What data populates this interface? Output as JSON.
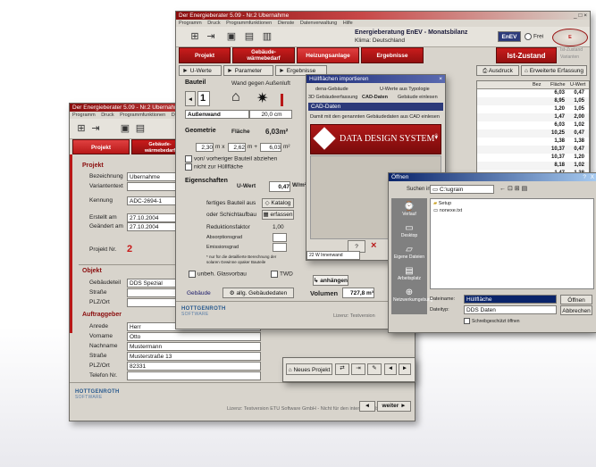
{
  "win1": {
    "title": "Der Energieberater 5.09 - Nr.2 Ubernahme",
    "menu": [
      "Programm",
      "Druck",
      "Programmfunktionen",
      "Dienste"
    ],
    "tabs": [
      "Projekt",
      "Gebäude-\nwärmebedarf"
    ],
    "projekt_section": "Projekt",
    "fields": [
      {
        "label": "Bezeichnung",
        "value": "Ubernahme"
      },
      {
        "label": "Variantentext",
        "value": ""
      },
      {
        "label": "Kennung",
        "value": "ADC-2694-1"
      },
      {
        "label": "Erstellt am",
        "value": "27.10.2004"
      },
      {
        "label": "Geändert am",
        "value": "27.10.2004"
      }
    ],
    "projekt_nr_label": "Projekt Nr.",
    "projekt_nr": "2",
    "objekt_section": "Objekt",
    "objekt_fields": [
      {
        "label": "Gebäudeteil",
        "value": "DDS Spezial"
      },
      {
        "label": "Straße",
        "value": ""
      },
      {
        "label": "PLZ/Ort",
        "value": ""
      }
    ],
    "auftrag_section": "Auftraggeber",
    "auftrag_fields": [
      {
        "label": "Anrede",
        "value": "Herr"
      },
      {
        "label": "Vorname",
        "value": "Otto"
      },
      {
        "label": "Nachname",
        "value": "Mustermann"
      },
      {
        "label": "Straße",
        "value": "Musterstraße 13"
      },
      {
        "label": "PLZ/Ort",
        "value": "82331"
      },
      {
        "label": "Telefon Nr.",
        "value": ""
      }
    ],
    "logo": "HOTTGENROTH",
    "logo_sub": "SOFTWARE",
    "license": "Lizenz: Testversion ETU Software GmbH - Nicht für den internen Gebrauch",
    "weiter": "weiter ►",
    "back": "◄"
  },
  "win2": {
    "title": "Der Energieberater 5.09 - Nr.2 Ubernahme",
    "menu": [
      "Programm",
      "Druck",
      "Programmfunktionen",
      "Dienste",
      "Datenverwaltung",
      "Hilfe"
    ],
    "header_title": "Energieberatung EnEV - Monatsbilanz",
    "klima": "Klima: Deutschland",
    "enev_btn": "EnEV",
    "frei": "Frei",
    "tabs": [
      "Projekt",
      "Gebäude-\nwärmebedarf",
      "Heizungsanlage",
      "Ergebnisse"
    ],
    "ist_zustand": "Ist-Zustand",
    "ist_side": [
      "Ist-Zustand",
      "Varianten"
    ],
    "subtabs": [
      "U-Werte",
      "Parameter",
      "Ergebnisse"
    ],
    "ausdruck": "Ausdruck",
    "erweiterte": "Erweiterte Erfassung",
    "bauteil_label": "Bauteil",
    "wand_label": "Wand gegen Außenluft",
    "counter": "1",
    "aussenwand": "Außenwand",
    "dicke": "20,0 cm",
    "geometrie_label": "Geometrie",
    "flaeche_label": "Fläche",
    "flaeche_value": "6,03m²",
    "geo_values": [
      "2,30",
      "2,62",
      "6,03"
    ],
    "geo_unit": "m²",
    "check1": "von/ vorheriger Bauteil abziehen",
    "check2": "nicht zur Hüllfläche",
    "eigen_label": "Eigenschaften",
    "uwert_label": "U-Wert",
    "uwert_value": "0,47",
    "uwert_unit": "W/m²K",
    "fertig_label": "fertiges Bauteil aus",
    "katalog": "Katalog",
    "schicht_label": "oder Schichtaufbau",
    "erfassen": "erfassen",
    "reduktion_label": "Reduktionsfaktor",
    "reduktion_value": "1,00",
    "absorption_label": "Absorptionsgrad",
    "emission_label": "Emissionsgrad",
    "note": "* nur für die detaillierte Berechnung der solaren Gewinne opaker Bauteile",
    "unbeh": "unbeh. Glasvorbau",
    "twd": "TWD",
    "gebaeude": "Gebäude",
    "allg": "allg. Gebäudedaten",
    "volumen_label": "Volumen",
    "volumen_value": "727,8 m³",
    "logo": "HOTTGENROTH",
    "logo_sub": "SOFTWARE",
    "license": "Lizenz: Testversion",
    "neues_projekt": "Neues Projekt",
    "anhaengen": "anhängen",
    "grid_headers": [
      "Bez",
      "Fläche",
      "U-Wert"
    ],
    "grid_rows": [
      [
        "6,03",
        "0,47"
      ],
      [
        "8,95",
        "1,05"
      ],
      [
        "1,20",
        "1,05"
      ],
      [
        "1,47",
        "2,00"
      ],
      [
        "6,03",
        "1,02"
      ],
      [
        "10,25",
        "0,47"
      ],
      [
        "1,38",
        "1,38"
      ],
      [
        "10,37",
        "0,47"
      ],
      [
        "10,37",
        "1,20"
      ],
      [
        "8,18",
        "1,02"
      ],
      [
        "1,47",
        "1,38"
      ]
    ]
  },
  "dialog": {
    "title": "Hüllflächen importieren",
    "tabs_row1": [
      "dena-Gebäude",
      "U-Werte aus Typologie"
    ],
    "tabs_row2": [
      "3D Gebäudeerfassung",
      "CAD-Daten",
      "Gebäude einlesen"
    ],
    "cad_header": "CAD-Daten",
    "desc": "Damit mit den genannten Gebäudedaten aus CAD einlesen",
    "dds": "DATA DESIGN SYSTEM",
    "reg": "®",
    "ok": "?",
    "list_row": [
      "22",
      "W",
      "Innenwand"
    ]
  },
  "filedlg": {
    "title": "Öffnen",
    "suchen_label": "Suchen in:",
    "suchen_value": "C:\\ugrain",
    "places": [
      "Verlauf",
      "Desktop",
      "Eigene Dateien",
      "Arbeitsplatz",
      "Netzwerkumgebung"
    ],
    "files": [
      "Setup",
      "nonexe.txt"
    ],
    "dateiname_label": "Dateiname:",
    "dateiname_value": "Hüllfläche",
    "dateityp_label": "Dateityp:",
    "dateityp_value": "DDS Daten",
    "schreib": "Schreibgeschützt öffnen",
    "oeffnen": "Öffnen",
    "abbrechen": "Abbrechen",
    "help": "?",
    "close": "X"
  }
}
